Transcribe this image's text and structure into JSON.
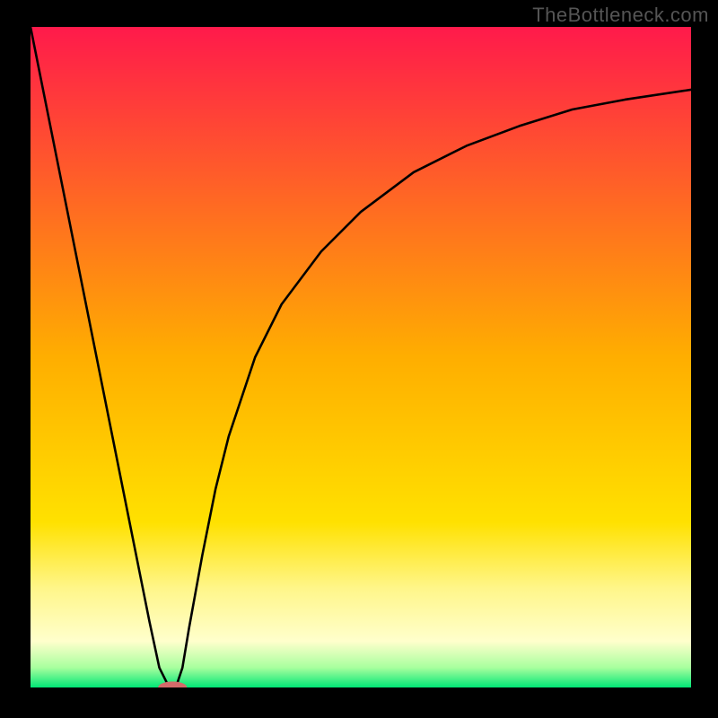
{
  "watermark": "TheBottleneck.com",
  "chart_data": {
    "type": "line",
    "title": "",
    "xlabel": "",
    "ylabel": "",
    "xlim": [
      0,
      100
    ],
    "ylim": [
      0,
      100
    ],
    "grid": false,
    "legend": false,
    "background_gradient": {
      "stops": [
        {
          "offset": 0.0,
          "color": "#ff1a4b"
        },
        {
          "offset": 0.5,
          "color": "#ffae00"
        },
        {
          "offset": 0.75,
          "color": "#ffe100"
        },
        {
          "offset": 0.85,
          "color": "#fff68a"
        },
        {
          "offset": 0.93,
          "color": "#ffffcc"
        },
        {
          "offset": 0.97,
          "color": "#a8ff9e"
        },
        {
          "offset": 1.0,
          "color": "#00e676"
        }
      ]
    },
    "series": [
      {
        "name": "bottleneck-curve",
        "x": [
          0,
          2,
          4,
          6,
          8,
          10,
          12,
          14,
          16,
          18,
          19.5,
          21,
          22,
          23,
          24,
          26,
          28,
          30,
          34,
          38,
          44,
          50,
          58,
          66,
          74,
          82,
          90,
          100
        ],
        "y": [
          100,
          90,
          80,
          70,
          60,
          50,
          40,
          30,
          20,
          10,
          3,
          0,
          0,
          3,
          9,
          20,
          30,
          38,
          50,
          58,
          66,
          72,
          78,
          82,
          85,
          87.5,
          89,
          90.5
        ]
      }
    ],
    "marker": {
      "name": "bottleneck-point",
      "x": 21.5,
      "y": 0,
      "rx": 2.2,
      "ry": 0.9,
      "color": "#d46a6a"
    }
  }
}
